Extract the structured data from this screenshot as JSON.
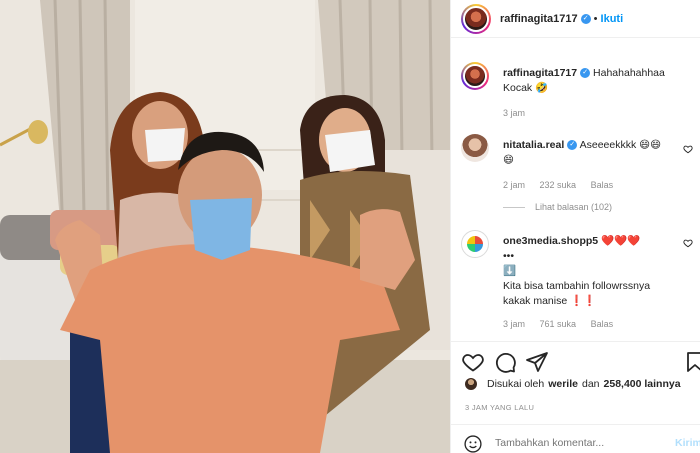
{
  "header": {
    "username": "raffinagita1717",
    "separator": "•",
    "follow_label": "Ikuti"
  },
  "comments": [
    {
      "username": "raffinagita1717",
      "text_line1": "Hahahahahhaa",
      "text_line2": "Kocak 🤣",
      "time": "3 jam"
    },
    {
      "username": "nitatalia.real",
      "text_line1": "Aseeeekkkk 😄😄",
      "text_line2": "😄",
      "time": "2 jam",
      "likes": "232 suka",
      "reply": "Balas",
      "view_replies": "Lihat balasan (102)"
    },
    {
      "username": "one3media.shopp5",
      "badge": "❤️❤️❤️",
      "text_line1": "•••",
      "text_line2": "⬇️",
      "text_line3": "Kita bisa tambahin followrssnya",
      "text_line4": "kakak manise ❗❗",
      "time": "3 jam",
      "likes": "761 suka",
      "reply": "Balas"
    }
  ],
  "likes_row": {
    "prefix": "Disukai oleh",
    "user": "werile",
    "conj": "dan",
    "count": "258,400 lainnya"
  },
  "time_ago": "3 JAM YANG LALU",
  "add_comment": {
    "placeholder": "Tambahkan komentar...",
    "post_label": "Kirim"
  },
  "icons": {
    "verified": "verified-badge-icon",
    "heart": "heart-icon",
    "comment": "comment-icon",
    "share": "share-icon",
    "save": "bookmark-icon",
    "emoji": "emoji-icon"
  },
  "colors": {
    "link_blue": "#0095f6",
    "verified_blue": "#3897f0",
    "muted": "#8e8e8e"
  }
}
